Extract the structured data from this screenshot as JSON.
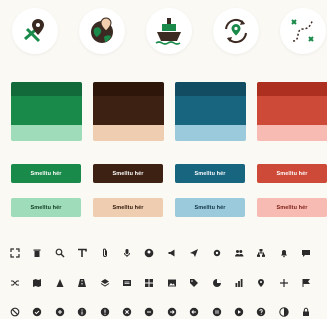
{
  "top_icons": [
    {
      "name": "map-pin-route-icon"
    },
    {
      "name": "globe-pin-icon"
    },
    {
      "name": "ship-icon"
    },
    {
      "name": "refresh-location-icon"
    },
    {
      "name": "route-path-icon"
    }
  ],
  "palettes": [
    {
      "band": "#12693a",
      "main": "#1a8a4a",
      "light": "#9fdcb9",
      "button_bg": "#1a8a4a",
      "soft_bg": "#9fdcb9",
      "soft_text": "#0f3b22"
    },
    {
      "band": "#2e160a",
      "main": "#3d2213",
      "light": "#efcdb0",
      "button_bg": "#3d2213",
      "soft_bg": "#efcdb0",
      "soft_text": "#2e160a"
    },
    {
      "band": "#114c63",
      "main": "#186580",
      "light": "#9ccadd",
      "button_bg": "#186580",
      "soft_bg": "#9ccadd",
      "soft_text": "#0c3344"
    },
    {
      "band": "#ad2f20",
      "main": "#cc4a37",
      "light": "#f8bbb3",
      "button_bg": "#cc4a37",
      "soft_bg": "#f8bbb3",
      "soft_text": "#7a1d12"
    }
  ],
  "buttons": {
    "label": "Smelltu hér"
  },
  "glyph_rows": [
    [
      "expand-icon",
      "trash-icon",
      "search-icon",
      "text-icon",
      "attachment-icon",
      "microphone-icon",
      "user-circle-icon",
      "megaphone-icon",
      "send-icon",
      "settings-icon",
      "users-icon",
      "sitemap-icon",
      "bell-icon",
      "chat-icon"
    ],
    [
      "shuffle-icon",
      "map-icon",
      "cone-icon",
      "road-icon",
      "layers-icon",
      "news-icon",
      "grid-icon",
      "image-icon",
      "tag-icon",
      "pie-icon",
      "chart-icon",
      "location-icon",
      "arrows-icon",
      "flag-icon"
    ],
    [
      "no-entry-icon",
      "check-circle-icon",
      "plus-circle-icon",
      "info-circle-icon",
      "warning-circle-icon",
      "x-circle-icon",
      "minus-circle-icon",
      "arrow-circle-icon",
      "back-circle-icon",
      "pause-circle-icon",
      "play-circle-icon",
      "help-circle-icon",
      "contrast-icon",
      "lock-icon"
    ]
  ],
  "colors": {
    "background": "#fbf9f4",
    "accent_green": "#1a8a4a",
    "ink": "#2b2b2b"
  }
}
